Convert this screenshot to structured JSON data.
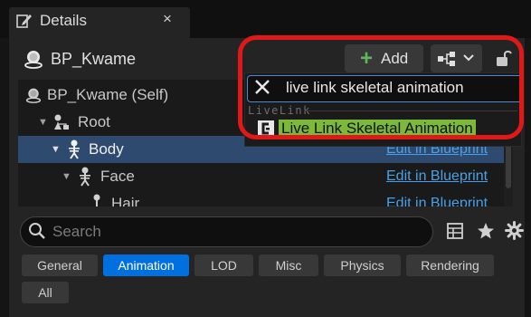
{
  "tab": {
    "title": "Details",
    "close_glyph": "×"
  },
  "actor": {
    "name": "BP_Kwame"
  },
  "toolbar": {
    "add_label": "Add",
    "add_glyph": "+"
  },
  "tree": {
    "rows": [
      {
        "label": "BP_Kwame (Self)"
      },
      {
        "label": "Root"
      },
      {
        "label": "Body",
        "link": "Edit in Blueprint",
        "selected": true
      },
      {
        "label": "Face",
        "link": "Edit in Blueprint"
      },
      {
        "label": "Hair",
        "link": "Edit in Blueprint"
      }
    ]
  },
  "search": {
    "placeholder": "Search"
  },
  "filters": [
    "General",
    "Animation",
    "LOD",
    "Misc",
    "Physics",
    "Rendering",
    "All"
  ],
  "active_filter": "Animation",
  "dropdown": {
    "query": "live link skeletal animation",
    "category": "LiveLink",
    "result": "Live Link Skeletal Animation"
  },
  "colors": {
    "accent": "#0070e0",
    "highlight": "#e01818",
    "match": "#7cb83a",
    "link": "#4aa0e8",
    "selected_row": "#2e4a6e"
  },
  "icons": [
    "details-icon",
    "close-icon",
    "actor-icon",
    "plus-icon",
    "blueprint-icon",
    "chevron-down-icon",
    "lock-icon",
    "skeleton-icon",
    "hierarchy-icon",
    "search-icon",
    "table-icon",
    "star-icon",
    "gear-icon",
    "clear-icon",
    "component-icon"
  ]
}
